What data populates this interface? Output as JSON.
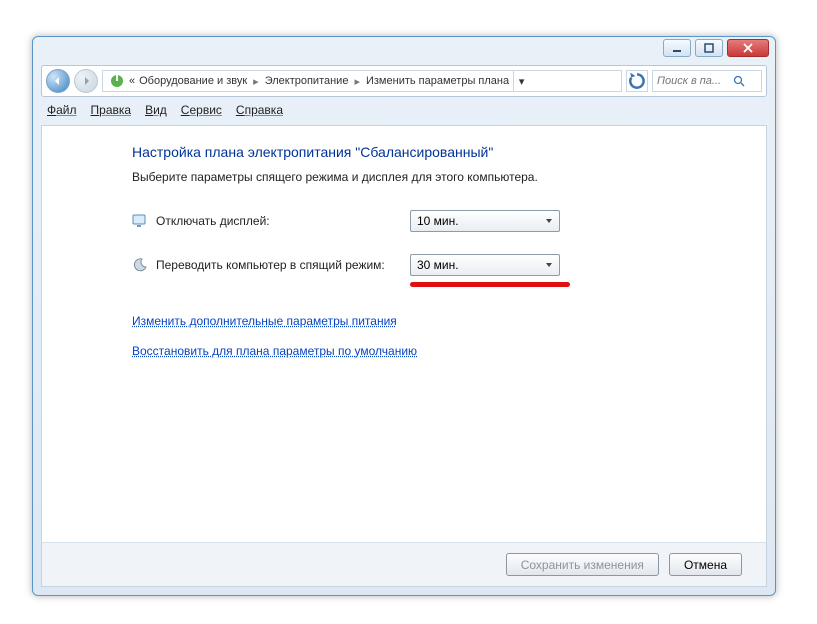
{
  "titlebar": {
    "minimize": "Minimize",
    "maximize": "Maximize",
    "close": "Close"
  },
  "nav": {
    "back": "Back",
    "forward": "Forward",
    "breadcrumb_prefix": "«",
    "crumb1": "Оборудование и звук",
    "crumb2": "Электропитание",
    "crumb3": "Изменить параметры плана",
    "refresh": "Refresh",
    "search_placeholder": "Поиск в па..."
  },
  "menu": {
    "file": "Файл",
    "edit": "Правка",
    "view": "Вид",
    "tools": "Сервис",
    "help": "Справка"
  },
  "page": {
    "heading": "Настройка плана электропитания \"Сбалансированный\"",
    "subheading": "Выберите параметры спящего режима и дисплея для этого компьютера.",
    "display_label": "Отключать дисплей:",
    "display_value": "10 мин.",
    "sleep_label": "Переводить компьютер в спящий режим:",
    "sleep_value": "30 мин.",
    "link_advanced": "Изменить дополнительные параметры питания",
    "link_restore": "Восстановить для плана параметры по умолчанию"
  },
  "footer": {
    "save": "Сохранить изменения",
    "cancel": "Отмена"
  }
}
